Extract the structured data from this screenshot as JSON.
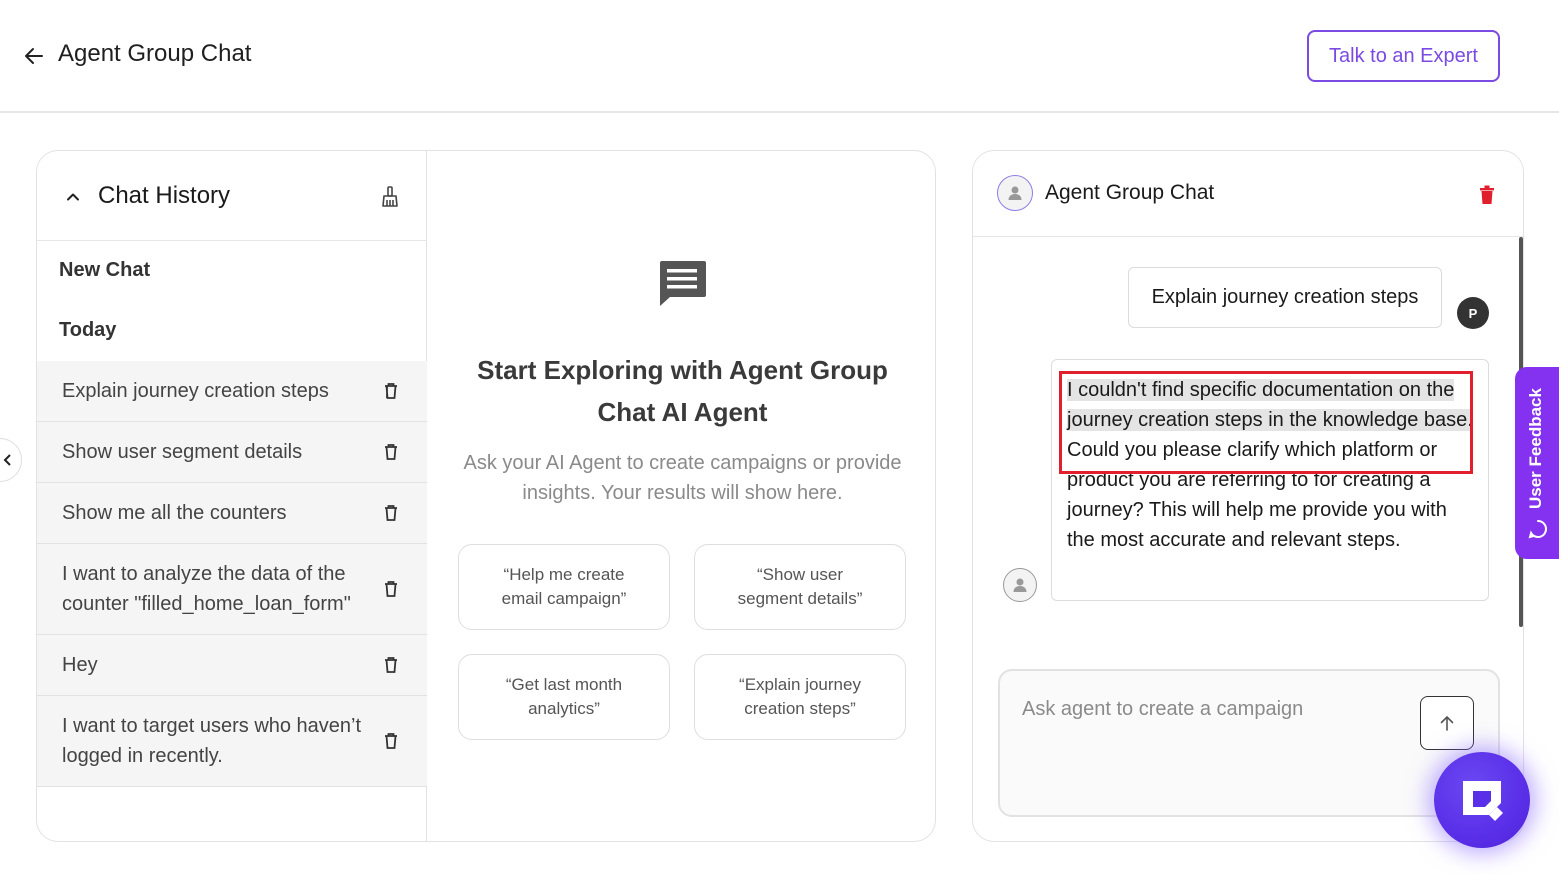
{
  "header": {
    "title": "Agent Group Chat",
    "expert_button": "Talk to an Expert"
  },
  "history": {
    "title": "Chat History",
    "new_chat": "New Chat",
    "section_today": "Today",
    "items": [
      {
        "label": "Explain journey creation steps"
      },
      {
        "label": "Show user segment details"
      },
      {
        "label": "Show me all the counters"
      },
      {
        "label": "I want to analyze the data of the counter \"filled_home_loan_form\""
      },
      {
        "label": "Hey"
      },
      {
        "label": "I want to target users who haven’t logged in recently."
      }
    ]
  },
  "explore": {
    "title": "Start Exploring with Agent Group Chat AI Agent",
    "subtitle": "Ask your AI Agent to create campaigns or provide insights. Your results will show here.",
    "suggestions": [
      {
        "label": "“Help me create email campaign”"
      },
      {
        "label": "“Show user segment details”"
      },
      {
        "label": "“Get last month analytics”"
      },
      {
        "label": "“Explain journey creation steps”"
      }
    ]
  },
  "chat": {
    "title": "Agent Group Chat",
    "user_message": "Explain journey creation steps",
    "user_initial": "P",
    "agent_message_highlighted": "I couldn't find specific documentation on the journey creation steps in the knowledge base.",
    "agent_message_rest": " Could you please clarify which platform or product you are referring to for creating a journey? This will help me provide you with the most accurate and relevant steps.",
    "input_placeholder": "Ask agent to create a campaign"
  },
  "feedback": {
    "label": "User Feedback"
  },
  "colors": {
    "accent": "#7b4ae2",
    "feedback": "#8431f0",
    "danger": "#e0202c",
    "fab": "#5a2fe8"
  }
}
